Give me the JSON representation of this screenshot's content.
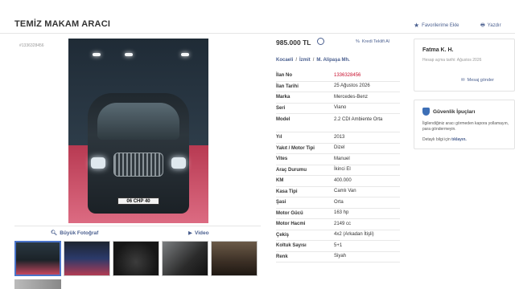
{
  "header": {
    "title": "TEMİZ MAKAM ARACI",
    "favorites_label": "Favorilerime Ekle",
    "print_label": "Yazdır"
  },
  "listing_id_small": "#1336328456",
  "photo": {
    "plate_text": "06 CHP 40",
    "big_photo_label": "Büyük Fotoğraf",
    "video_label": "Video"
  },
  "price": {
    "value": "985.000 TL",
    "credit_label": "Kredi Teklifi Al"
  },
  "location": {
    "city": "Kocaeli",
    "district": "İzmit",
    "neighborhood": "M. Alipaşa Mh."
  },
  "details": [
    {
      "key": "İlan No",
      "value": "1336328456"
    },
    {
      "key": "İlan Tarihi",
      "value": "25 Ağustos 2026"
    },
    {
      "key": "Marka",
      "value": "Mercedes-Benz"
    },
    {
      "key": "Seri",
      "value": "Viano"
    },
    {
      "key": "Model",
      "value": "2.2 CDI Ambiente Orta"
    },
    {
      "key": "Yıl",
      "value": "2013"
    },
    {
      "key": "Yakıt / Motor Tipi",
      "value": "Dizel"
    },
    {
      "key": "Vites",
      "value": "Manuel"
    },
    {
      "key": "Araç Durumu",
      "value": "İkinci El"
    },
    {
      "key": "KM",
      "value": "400.000"
    },
    {
      "key": "Kasa Tipi",
      "value": "Camlı Van"
    },
    {
      "key": "Şasi",
      "value": "Orta"
    },
    {
      "key": "Motor Gücü",
      "value": "163 hp"
    },
    {
      "key": "Motor Hacmi",
      "value": "2149 cc"
    },
    {
      "key": "Çekiş",
      "value": "4x2 (Arkadan İtişli)"
    },
    {
      "key": "Koltuk Sayısı",
      "value": "5+1"
    },
    {
      "key": "Renk",
      "value": "Siyah"
    }
  ],
  "seller": {
    "name": "Fatma K. H.",
    "since": "Hesap açma tarihi: Ağustos 2026",
    "message_label": "Mesaj gönder"
  },
  "safety": {
    "title": "Güvenlik İpuçları",
    "text": "İlgilendiğiniz aracı görmeden kapora yollamayın, para göndermeyin.",
    "more_prefix": "Detaylı bilgi için",
    "more_link": "tıklayın."
  },
  "colors": {
    "accent_link": "#4a5f8f",
    "listing_no": "#c8102e"
  }
}
